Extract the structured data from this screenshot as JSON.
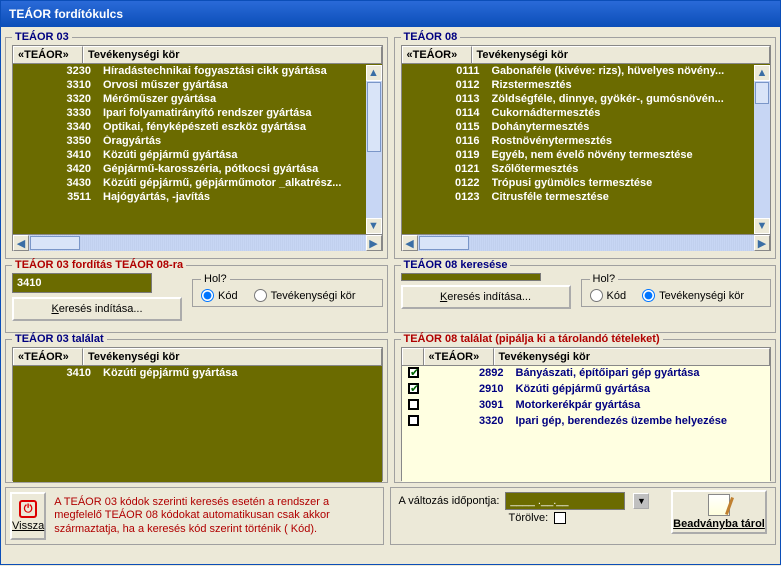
{
  "window": {
    "title": "TEÁOR fordítókulcs"
  },
  "teaor03": {
    "legend": "TEÁOR 03",
    "col_code": "«TEÁOR»",
    "col_activity": "Tevékenységi kör",
    "rows": [
      {
        "code": "3230",
        "name": "Híradástechnikai fogyasztási cikk gyártása"
      },
      {
        "code": "3310",
        "name": "Orvosi műszer gyártása"
      },
      {
        "code": "3320",
        "name": "Mérőműszer gyártása"
      },
      {
        "code": "3330",
        "name": "Ipari folyamatirányító rendszer gyártása"
      },
      {
        "code": "3340",
        "name": "Optikai, fényképészeti eszköz gyártása"
      },
      {
        "code": "3350",
        "name": "Óragyártás"
      },
      {
        "code": "3410",
        "name": "Közúti gépjármű gyártása"
      },
      {
        "code": "3420",
        "name": "Gépjármű-karosszéria, pótkocsi gyártása"
      },
      {
        "code": "3430",
        "name": "Közúti gépjármű, gépjárműmotor _alkatrész..."
      },
      {
        "code": "3511",
        "name": "Hajógyártás, -javítás"
      }
    ]
  },
  "teaor08": {
    "legend": "TEÁOR 08",
    "col_code": "«TEÁOR»",
    "col_activity": "Tevékenységi kör",
    "rows": [
      {
        "code": "0111",
        "name": "Gabonaféle (kivéve: rizs), hüvelyes növény..."
      },
      {
        "code": "0112",
        "name": "Rizstermesztés"
      },
      {
        "code": "0113",
        "name": "Zöldségféle, dinnye, gyökér-, gumósnövén..."
      },
      {
        "code": "0114",
        "name": "Cukornádtermesztés"
      },
      {
        "code": "0115",
        "name": "Dohánytermesztés"
      },
      {
        "code": "0116",
        "name": "Rostnövénytermesztés"
      },
      {
        "code": "0119",
        "name": "Egyéb, nem évelő növény termesztése"
      },
      {
        "code": "0121",
        "name": "Szőlőtermesztés"
      },
      {
        "code": "0122",
        "name": "Trópusi gyümölcs termesztése"
      },
      {
        "code": "0123",
        "name": "Citrusféle termesztése"
      }
    ]
  },
  "search03": {
    "legend": "TEÁOR 03 fordítás TEÁOR 08-ra",
    "value": "3410",
    "hol_label": "Hol?",
    "opt_code": "Kód",
    "opt_activity": "Tevékenységi kör",
    "button": "Keresés indítása..."
  },
  "search08": {
    "legend": "TEÁOR 08 keresése",
    "value": "",
    "hol_label": "Hol?",
    "opt_code": "Kód",
    "opt_activity": "Tevékenységi kör",
    "button": "Keresés indítása..."
  },
  "result03": {
    "legend": "TEÁOR 03 találat",
    "col_code": "«TEÁOR»",
    "col_activity": "Tevékenységi kör",
    "rows": [
      {
        "code": "3410",
        "name": "Közúti gépjármű gyártása"
      }
    ]
  },
  "result08": {
    "legend": "TEÁOR 08 találat (pipálja ki a tárolandó tételeket)",
    "col_code": "«TEÁOR»",
    "col_activity": "Tevékenységi kör",
    "rows": [
      {
        "checked": true,
        "code": "2892",
        "name": "Bányászati, építőipari gép gyártása"
      },
      {
        "checked": true,
        "code": "2910",
        "name": "Közúti gépjármű gyártása"
      },
      {
        "checked": false,
        "code": "3091",
        "name": "Motorkerékpár gyártása"
      },
      {
        "checked": false,
        "code": "3320",
        "name": "Ipari gép, berendezés üzembe helyezése"
      }
    ]
  },
  "footer": {
    "back_label": "Vissza",
    "warning": "A TEÁOR 03 kódok szerinti keresés esetén a rendszer a megfelelő TEÁOR 08 kódokat automatikusan csak akkor származtatja, ha a keresés kód szerint történik (     Kód).",
    "change_date_label": "A változás időpontja:",
    "change_date_value": "____ .__.__",
    "deleted_label": "Törölve:",
    "store_label": "Beadványba tárol"
  }
}
